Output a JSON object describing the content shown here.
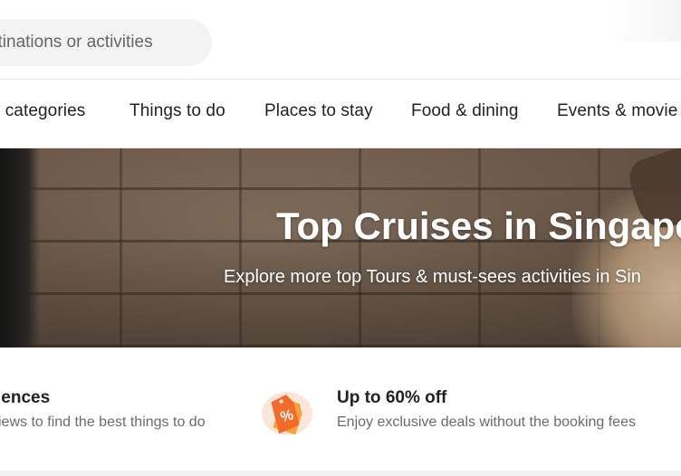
{
  "header": {
    "search_placeholder": "stinations or activities"
  },
  "nav": {
    "items": [
      {
        "label": "l categories"
      },
      {
        "label": "Things to do"
      },
      {
        "label": "Places to stay"
      },
      {
        "label": "Food & dining"
      },
      {
        "label": "Events & movie"
      }
    ]
  },
  "hero": {
    "title": "Top Cruises in Singapor",
    "subtitle": "Explore more top Tours & must-sees activities in Sin"
  },
  "features": [
    {
      "title": "iences",
      "description": "iews to find the best things to do"
    },
    {
      "icon": "discount-tag-icon",
      "icon_glyph": "%",
      "title": "Up to 60% off",
      "description": "Enjoy exclusive deals without the booking fees"
    }
  ],
  "colors": {
    "accent_orange": "#f26b2a",
    "tag_dark_orange": "#e0541b",
    "text_primary": "#222222",
    "text_secondary": "#6b6b6b"
  }
}
